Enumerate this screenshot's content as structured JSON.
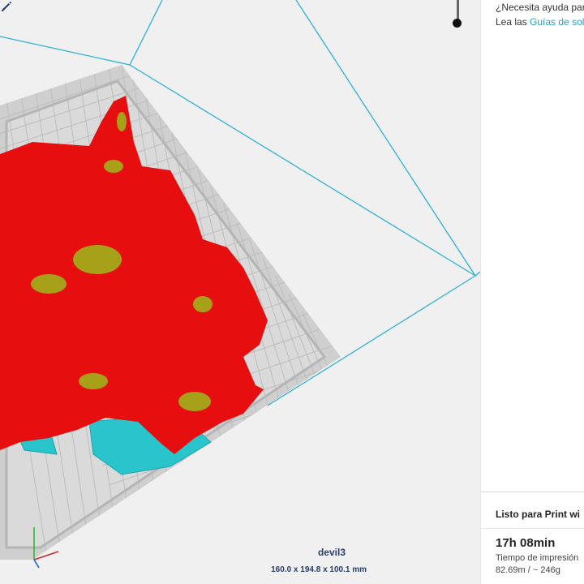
{
  "help": {
    "question": "¿Necesita ayuda par",
    "prefix": "Lea las ",
    "link": "Guías de solu"
  },
  "model": {
    "name": "devil3",
    "dimensions": "160.0 x 194.8 x 100.1 mm"
  },
  "print_status": {
    "title": "Listo para Print wi",
    "time": "17h 08min",
    "time_label": "Tiempo de impresión",
    "material": "82.69m / ~ 246g"
  },
  "colors": {
    "model_red": "#e60e0e",
    "support_cyan": "#29c4cc",
    "build_volume_line": "#2fb0d6",
    "accent_link": "#1fa2c8",
    "name_text": "#2a3e6b"
  },
  "icons": [
    "pencil-icon",
    "layer-slider-handle"
  ]
}
